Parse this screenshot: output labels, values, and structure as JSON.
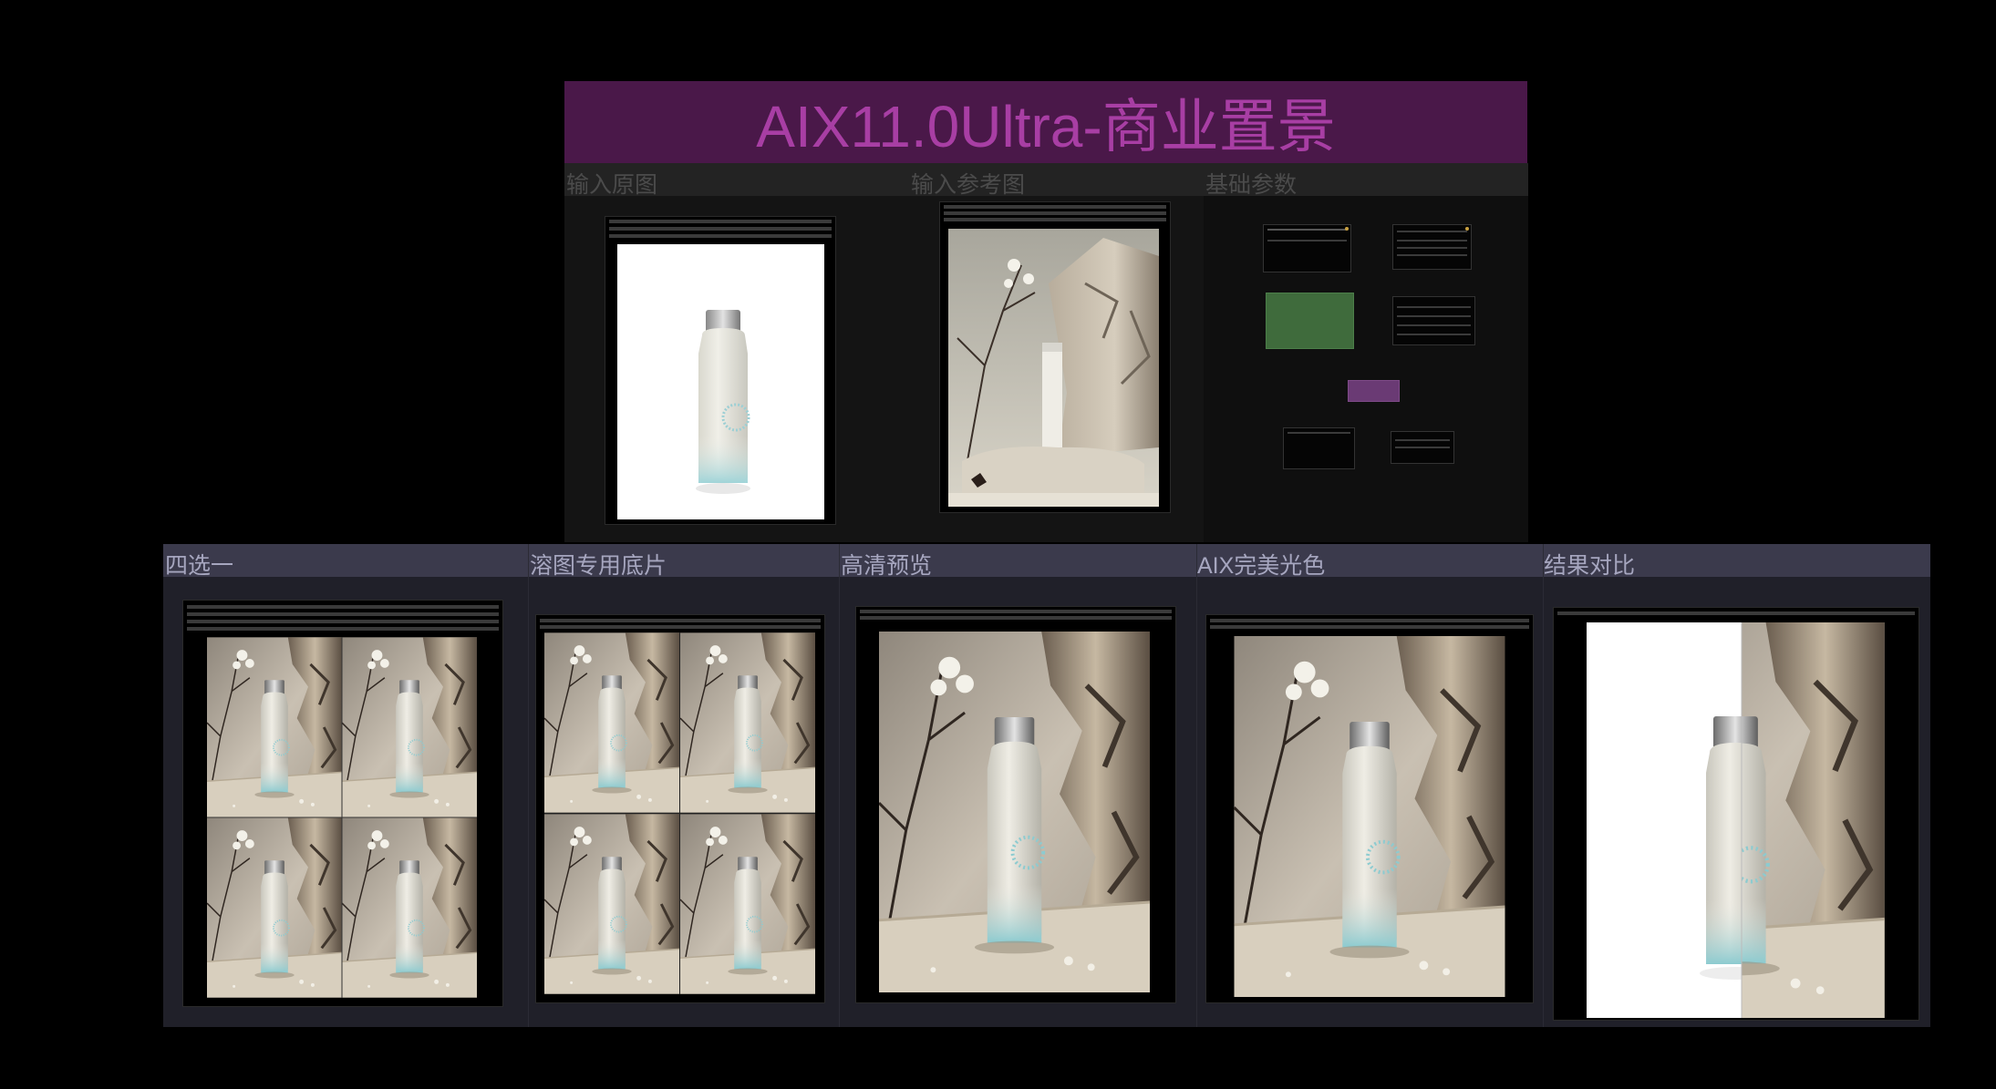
{
  "header": {
    "title": "AIX11.0Ultra-商业置景"
  },
  "top_groups": [
    {
      "label": "输入原图"
    },
    {
      "label": "输入参考图"
    },
    {
      "label": "基础参数"
    }
  ],
  "bottom_groups": [
    {
      "label": "四选一"
    },
    {
      "label": "溶图专用底片"
    },
    {
      "label": "高清预览"
    },
    {
      "label": "AIX完美光色"
    },
    {
      "label": "结果对比"
    }
  ],
  "colors": {
    "banner_bg": "#4a1849",
    "banner_text": "#a83ea4",
    "param_green": "#3f6b3c",
    "param_purple": "#6a3a74"
  },
  "icons": [
    "bottle-photo",
    "rock-scene-photo",
    "flower-branch"
  ]
}
